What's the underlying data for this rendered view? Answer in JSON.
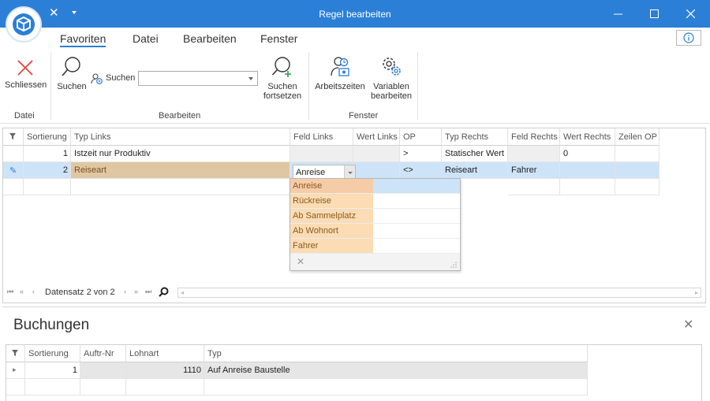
{
  "window": {
    "title": "Regel bearbeiten",
    "close_glyph": "✕",
    "min_glyph": "—",
    "max_glyph": "☐"
  },
  "colors": {
    "accent": "#2b7fd6",
    "selection": "#cde3f7",
    "highlight": "#fbdcb4"
  },
  "menu": {
    "tabs": [
      "Favoriten",
      "Datei",
      "Bearbeiten",
      "Fenster"
    ],
    "active": "Favoriten",
    "info_glyph": "ⓘ"
  },
  "ribbon": {
    "close_label": "Schliessen",
    "search_label": "Suchen",
    "search_field_label": "Suchen",
    "search_value": "",
    "continue_label_1": "Suchen",
    "continue_label_2": "fortsetzen",
    "worktimes_label": "Arbeitszeiten",
    "variables_label_1": "Variablen",
    "variables_label_2": "bearbeiten",
    "groups": [
      "Datei",
      "Bearbeiten",
      "Fenster"
    ]
  },
  "rules_grid": {
    "columns": [
      "Sortierung",
      "Typ Links",
      "Feld Links",
      "Wert Links",
      "OP",
      "Typ Rechts",
      "Feld Rechts",
      "Wert Rechts",
      "Zeilen OP"
    ],
    "rows": [
      {
        "sort": "1",
        "type_left": "Istzeit nur Produktiv",
        "field_left": "",
        "value_left": "",
        "op": ">",
        "type_right": "Statischer Wert",
        "field_right": "",
        "value_right": "0",
        "row_op": ""
      },
      {
        "sort": "2",
        "type_left": "Reiseart",
        "field_left": "Anreise",
        "value_left": "",
        "op": "<>",
        "type_right": "Reiseart",
        "field_right": "Fahrer",
        "value_right": "",
        "row_op": ""
      }
    ],
    "edit_glyph": "✎",
    "dropdown_options": [
      "Anreise",
      "Rückreise",
      "Ab Sammelplatz",
      "Ab Wohnort",
      "Fahrer"
    ],
    "dropdown_clear_glyph": "✕",
    "navigator_text": "Datensatz 2 von 2"
  },
  "bookings": {
    "title": "Buchungen",
    "close_glyph": "✕",
    "columns": [
      "Sortierung",
      "Auftr-Nr",
      "Lohnart",
      "Typ"
    ],
    "rows": [
      {
        "sort": "1",
        "order_no": "",
        "wage_type": "1110",
        "type": "Auf Anreise Baustelle"
      }
    ]
  }
}
